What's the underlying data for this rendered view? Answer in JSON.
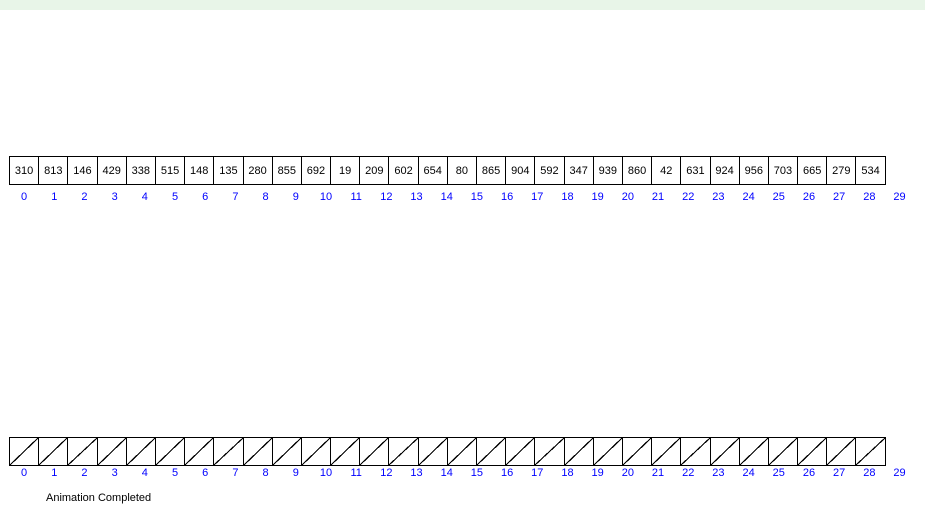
{
  "top_array": {
    "values": [
      310,
      813,
      146,
      429,
      338,
      515,
      148,
      135,
      280,
      855,
      692,
      19,
      209,
      602,
      654,
      80,
      865,
      904,
      592,
      347,
      939,
      860,
      42,
      631,
      924,
      956,
      703,
      665,
      279,
      534
    ],
    "indices": [
      0,
      1,
      2,
      3,
      4,
      5,
      6,
      7,
      8,
      9,
      10,
      11,
      12,
      13,
      14,
      15,
      16,
      17,
      18,
      19,
      20,
      21,
      22,
      23,
      24,
      25,
      26,
      27,
      28,
      29
    ]
  },
  "bottom_array": {
    "count": 30,
    "indices": [
      0,
      1,
      2,
      3,
      4,
      5,
      6,
      7,
      8,
      9,
      10,
      11,
      12,
      13,
      14,
      15,
      16,
      17,
      18,
      19,
      20,
      21,
      22,
      23,
      24,
      25,
      26,
      27,
      28,
      29
    ]
  },
  "status": "Animation Completed",
  "colors": {
    "index_color": "#0000ff",
    "banner_color": "#e8f5e8"
  }
}
